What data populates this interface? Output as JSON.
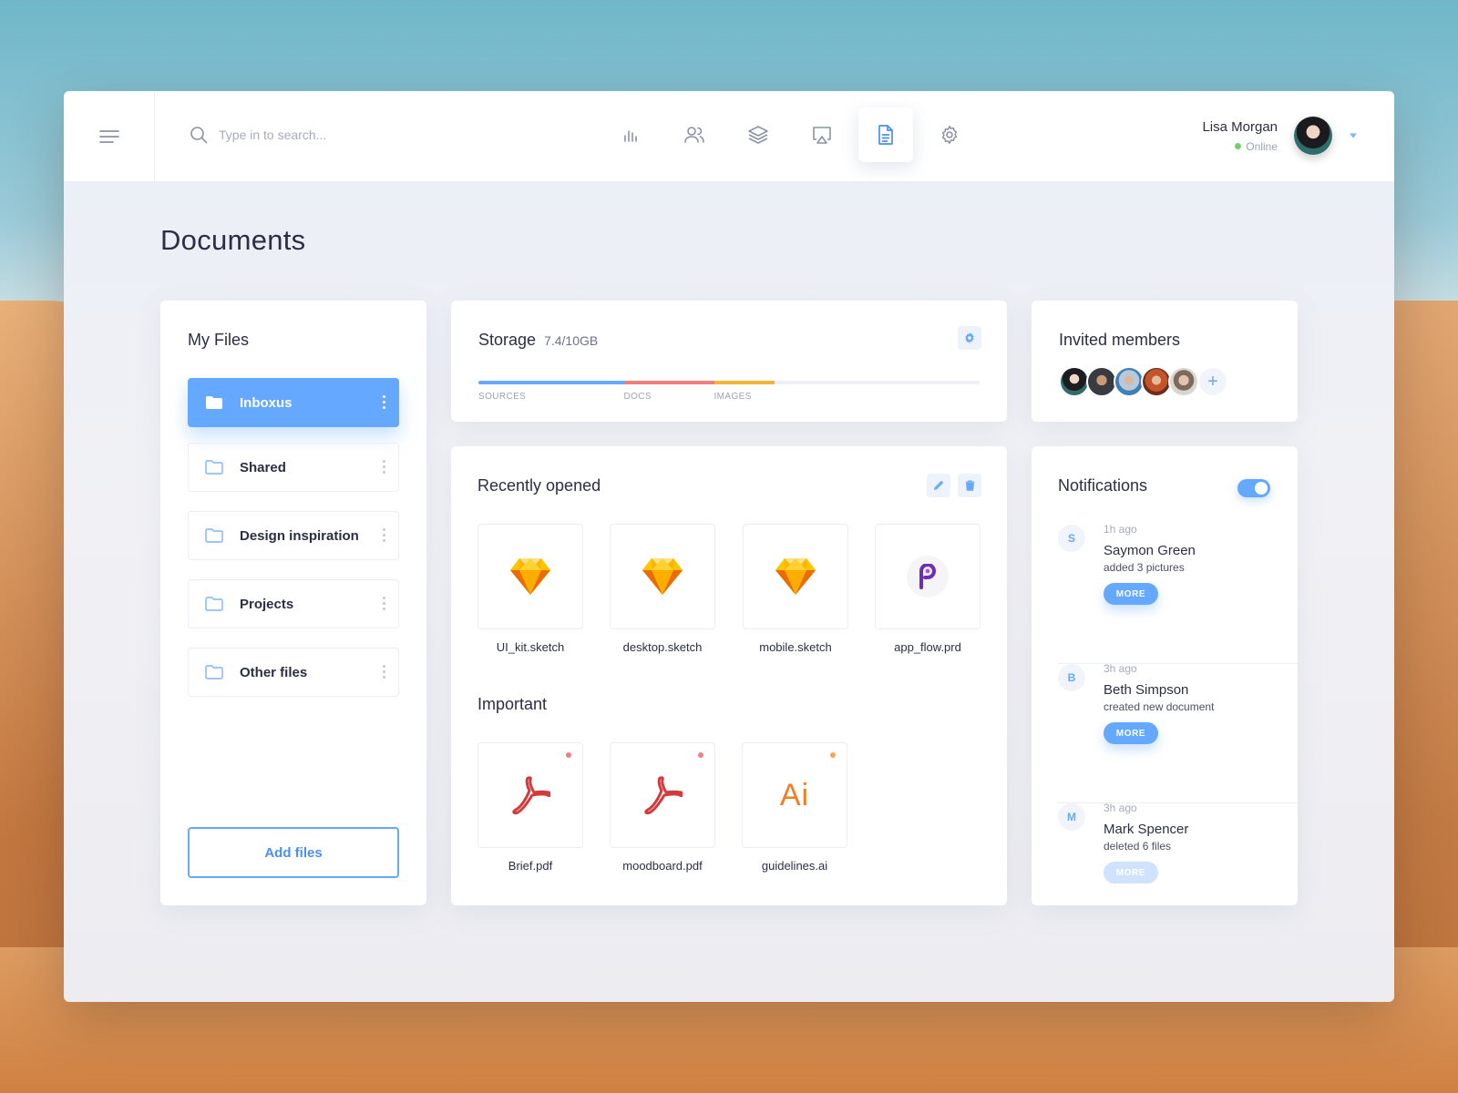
{
  "search": {
    "placeholder": "Type in to search..."
  },
  "nav": [
    {
      "icon": "bar-chart-icon",
      "active": false
    },
    {
      "icon": "users-icon",
      "active": false
    },
    {
      "icon": "layers-icon",
      "active": false
    },
    {
      "icon": "airplay-icon",
      "active": false
    },
    {
      "icon": "document-icon",
      "active": true
    },
    {
      "icon": "settings-icon",
      "active": false
    }
  ],
  "user": {
    "name": "Lisa Morgan",
    "status": "Online"
  },
  "page": {
    "title": "Documents"
  },
  "my_files": {
    "title": "My Files",
    "folders": [
      {
        "label": "Inboxus",
        "active": true
      },
      {
        "label": "Shared",
        "active": false
      },
      {
        "label": "Design inspiration",
        "active": false
      },
      {
        "label": "Projects",
        "active": false
      },
      {
        "label": "Other files",
        "active": false
      }
    ],
    "add_label": "Add files"
  },
  "storage": {
    "title": "Storage",
    "value": "7.4/10GB",
    "segments": [
      {
        "label": "SOURCES",
        "fraction": 0.29,
        "color": "#64a8ff"
      },
      {
        "label": "DOCS",
        "fraction": 0.18,
        "color": "#ef7f7f"
      },
      {
        "label": "IMAGES",
        "fraction": 0.12,
        "color": "#f7b538"
      }
    ]
  },
  "invited": {
    "title": "Invited members",
    "add_symbol": "+"
  },
  "recent": {
    "title": "Recently opened",
    "files": [
      {
        "name": "UI_kit.sketch",
        "icon": "sketch-icon"
      },
      {
        "name": "desktop.sketch",
        "icon": "sketch-icon"
      },
      {
        "name": "mobile.sketch",
        "icon": "sketch-icon"
      },
      {
        "name": "app_flow.prd",
        "icon": "protopie-icon"
      }
    ]
  },
  "important": {
    "title": "Important",
    "files": [
      {
        "name": "Brief.pdf",
        "icon": "pdf-icon",
        "dot": "#ef7f7f"
      },
      {
        "name": "moodboard.pdf",
        "icon": "pdf-icon",
        "dot": "#ef7f7f"
      },
      {
        "name": "guidelines.ai",
        "icon": "illustrator-icon",
        "icon_text": "Ai",
        "dot": "#f7a64a"
      }
    ]
  },
  "notifications": {
    "title": "Notifications",
    "enabled": true,
    "items": [
      {
        "initial": "S",
        "time": "1h ago",
        "name": "Saymon Green",
        "action": "added 3 pictures",
        "button": "MORE"
      },
      {
        "initial": "B",
        "time": "3h ago",
        "name": "Beth Simpson",
        "action": "created new document",
        "button": "MORE"
      },
      {
        "initial": "M",
        "time": "3h ago",
        "name": "Mark Spencer",
        "action": "deleted 6 files",
        "button": "MORE"
      }
    ]
  }
}
